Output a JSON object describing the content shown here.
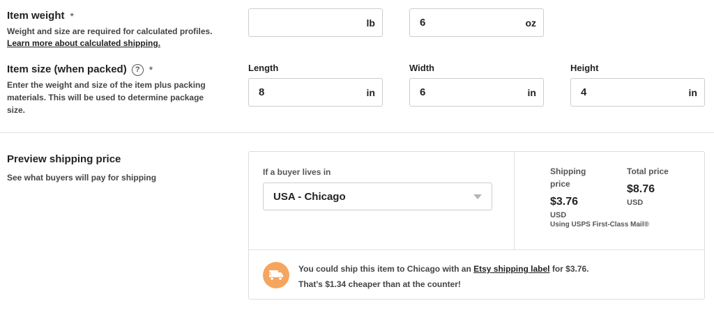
{
  "weight": {
    "title": "Item weight",
    "required_mark": "*",
    "description": "Weight and size are required for calculated profiles.",
    "learn_more": "Learn more about calculated shipping.",
    "lb": {
      "value": "",
      "unit": "lb"
    },
    "oz": {
      "value": "6",
      "unit": "oz"
    }
  },
  "size": {
    "title": "Item size (when packed)",
    "help_glyph": "?",
    "required_mark": "*",
    "description_line1": "Enter the weight and size of the item plus packing",
    "description_line2": "materials. This will be used to determine package",
    "description_line3": "size.",
    "length": {
      "label": "Length",
      "value": "8",
      "unit": "in"
    },
    "width": {
      "label": "Width",
      "value": "6",
      "unit": "in"
    },
    "height": {
      "label": "Height",
      "value": "4",
      "unit": "in"
    }
  },
  "preview": {
    "title": "Preview shipping price",
    "subtitle": "See what buyers will pay for shipping",
    "buyer_label": "If a buyer lives in",
    "buyer_location": "USA - Chicago",
    "shipping_price_label_line1": "Shipping",
    "shipping_price_label_line2": "price",
    "shipping_price": "$3.76",
    "shipping_currency": "USD",
    "service_note": "Using USPS First-Class Mail®",
    "total_price_label": "Total price",
    "total_price": "$8.76",
    "total_currency": "USD"
  },
  "notice": {
    "line1_prefix": "You could ship this item to Chicago with an ",
    "link_text": "Etsy shipping label",
    "line1_suffix": " for $3.76.",
    "line2": "That's $1.34 cheaper than at the counter!"
  },
  "colors": {
    "truck_badge": "#f6a55f",
    "border": "#cccccc",
    "divider": "#e1e1e1"
  },
  "icons": {
    "help": "question-circle-icon",
    "truck": "delivery-truck-icon",
    "caret": "caret-down-icon"
  }
}
